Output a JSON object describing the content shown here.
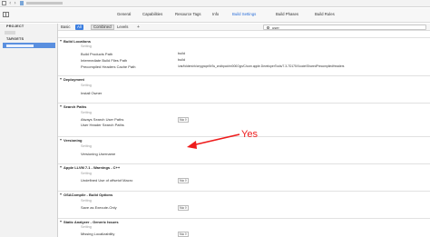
{
  "tabs": [
    {
      "label": "General"
    },
    {
      "label": "Capabilities"
    },
    {
      "label": "Resource Tags"
    },
    {
      "label": "Info"
    },
    {
      "label": "Build Settings"
    },
    {
      "label": "Build Phases"
    },
    {
      "label": "Build Rules"
    }
  ],
  "nav": {
    "project_header": "PROJECT",
    "targets_header": "TARGETS"
  },
  "filter": {
    "basic": "Basic",
    "all": "All",
    "combined": "Combined",
    "levels": "Levels",
    "add": "+",
    "search_value": "user"
  },
  "sections": {
    "build_locations": {
      "title": "Build Locations",
      "setting": "Setting",
      "rows": [
        {
          "label": "Build Products Path",
          "value": "build"
        },
        {
          "label": "Intermediate Build Files Path",
          "value": "build"
        },
        {
          "label": "Precompiled Headers Cache Path",
          "value": "/var/folders/rk/cnygnqxr5rSs_zndbpcd/mi000Ogn/C/com.apple.DeveloperTools/7.3-7D175/Xcode/SharedPrecompiledHeaders"
        }
      ]
    },
    "deployment": {
      "title": "Deployment",
      "setting": "Setting",
      "rows": [
        {
          "label": "Install Owner",
          "value": ""
        }
      ]
    },
    "search_paths": {
      "title": "Search Paths",
      "setting": "Setting",
      "rows": [
        {
          "label": "Always Search User Paths",
          "value": "No ◊"
        },
        {
          "label": "User Header Search Paths",
          "value": ""
        }
      ]
    },
    "versioning": {
      "title": "Versioning",
      "setting": "Setting",
      "rows": [
        {
          "label": "Versioning Username",
          "value": ""
        }
      ]
    },
    "llvm": {
      "title": "Apple LLVM 7.1 - Warnings - C++",
      "setting": "Setting",
      "rows": [
        {
          "label": "Undefined Use of offsetof Macro",
          "value": "No ◊"
        }
      ]
    },
    "osacompile": {
      "title": "OSACompile - Build Options",
      "setting": "Setting",
      "rows": [
        {
          "label": "Save as Execute-Only",
          "value": "No ◊"
        }
      ]
    },
    "static_analyzer": {
      "title": "Static Analyzer - Generic Issues",
      "setting": "Setting",
      "rows": [
        {
          "label": "Missing Localizability",
          "value": "No ◊"
        }
      ]
    }
  },
  "annotation": {
    "text": "Yes",
    "color": "#ee1c1c"
  }
}
